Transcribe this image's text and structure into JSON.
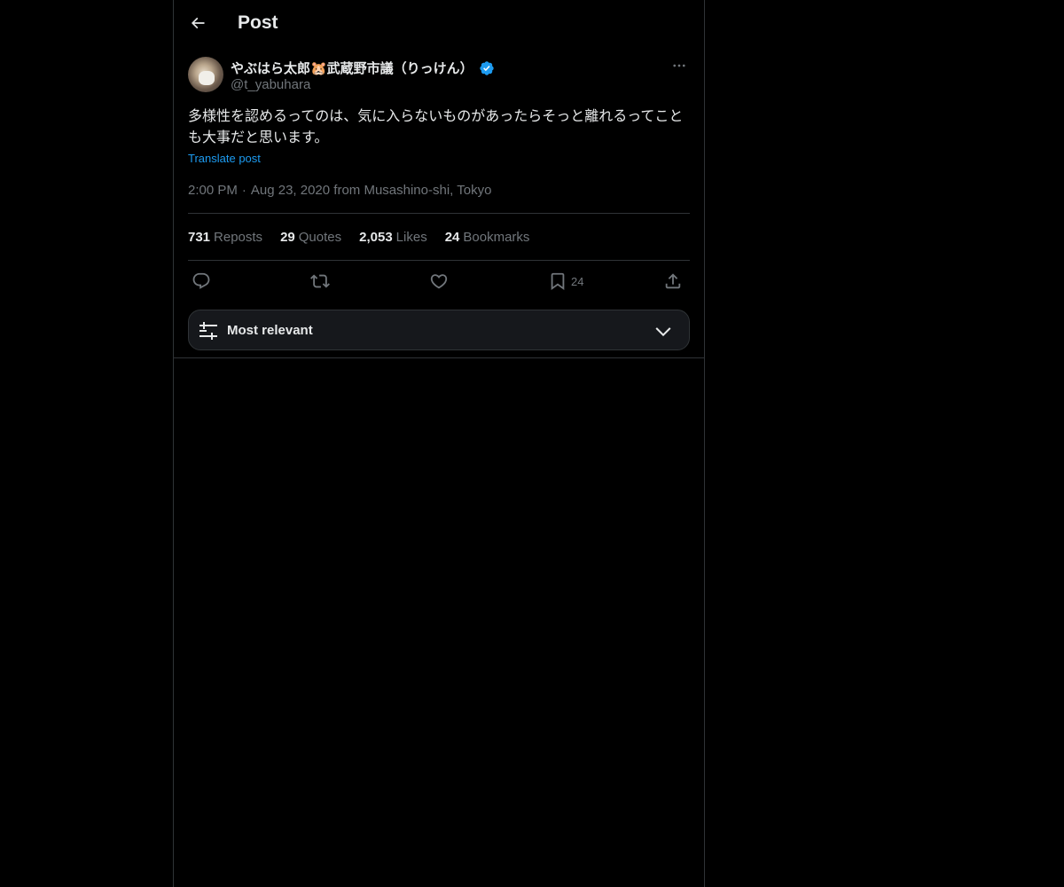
{
  "header": {
    "title": "Post"
  },
  "author": {
    "name": "やぶはら太郎🐹武蔵野市議（りっけん）",
    "handle": "@t_yabuhara",
    "verified_color": "#1d9bf0"
  },
  "tweet": {
    "text": "多様性を認めるってのは、気に入らないものがあったらそっと離れるってことも大事だと思います。",
    "translate_label": "Translate post",
    "time": "2:00 PM",
    "separator": "·",
    "date_location": "Aug 23, 2020 from Musashino-shi, Tokyo"
  },
  "stats": {
    "reposts_count": "731",
    "reposts_label": "Reposts",
    "quotes_count": "29",
    "quotes_label": "Quotes",
    "likes_count": "2,053",
    "likes_label": "Likes",
    "bookmarks_count": "24",
    "bookmarks_label": "Bookmarks"
  },
  "actions": {
    "reply_icon": "reply-icon",
    "repost_icon": "repost-icon",
    "like_icon": "heart-icon",
    "bookmark_icon": "bookmark-icon",
    "bookmark_count": "24",
    "share_icon": "share-icon"
  },
  "sort": {
    "label": "Most relevant"
  },
  "colors": {
    "background": "#000000",
    "text": "#e7e9ea",
    "muted": "#71767b",
    "accent": "#1d9bf0",
    "border": "#2f3336"
  }
}
